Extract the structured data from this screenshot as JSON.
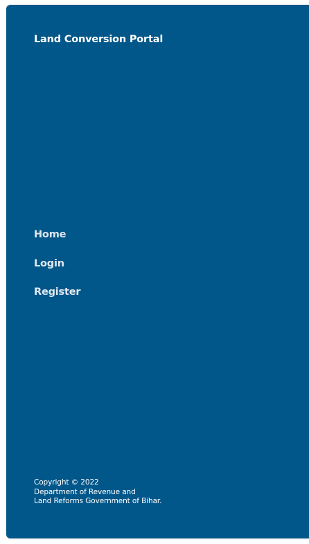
{
  "sidebar": {
    "title": "Land Conversion Portal",
    "nav": [
      {
        "label": "Home"
      },
      {
        "label": "Login"
      },
      {
        "label": "Register"
      }
    ],
    "footer": {
      "line1": "Copyright © 2022",
      "line2": "Department of Revenue and",
      "line3": "Land Reforms Government of Bihar."
    }
  },
  "colors": {
    "panel_background": "#02578a",
    "title_text": "#ffffff",
    "nav_text": "#dfe7ef"
  }
}
